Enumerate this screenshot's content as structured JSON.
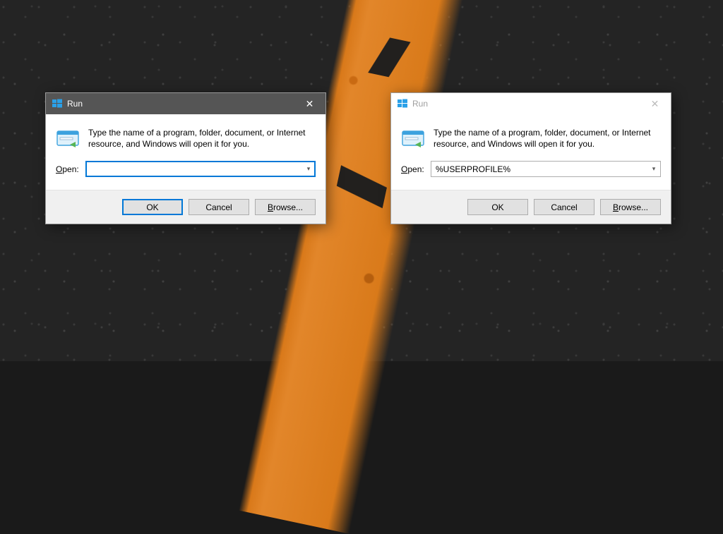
{
  "run_left": {
    "title": "Run",
    "description": "Type the name of a program, folder, document, or Internet resource, and Windows will open it for you.",
    "open_label": "Open:",
    "open_underline": "O",
    "open_rest": "pen:",
    "input_value": "",
    "buttons": {
      "ok": "OK",
      "cancel": "Cancel",
      "browse_u": "B",
      "browse_rest": "rowse..."
    },
    "active": true
  },
  "run_right": {
    "title": "Run",
    "description": "Type the name of a program, folder, document, or Internet resource, and Windows will open it for you.",
    "open_label": "Open:",
    "open_underline": "O",
    "open_rest": "pen:",
    "input_value": "%USERPROFILE%",
    "buttons": {
      "ok": "OK",
      "cancel": "Cancel",
      "browse_u": "B",
      "browse_rest": "rowse..."
    },
    "active": false
  },
  "icons": {
    "windows": "windows-logo-icon",
    "run": "run-dialog-icon",
    "close": "close-icon",
    "chevron": "chevron-down-icon"
  }
}
